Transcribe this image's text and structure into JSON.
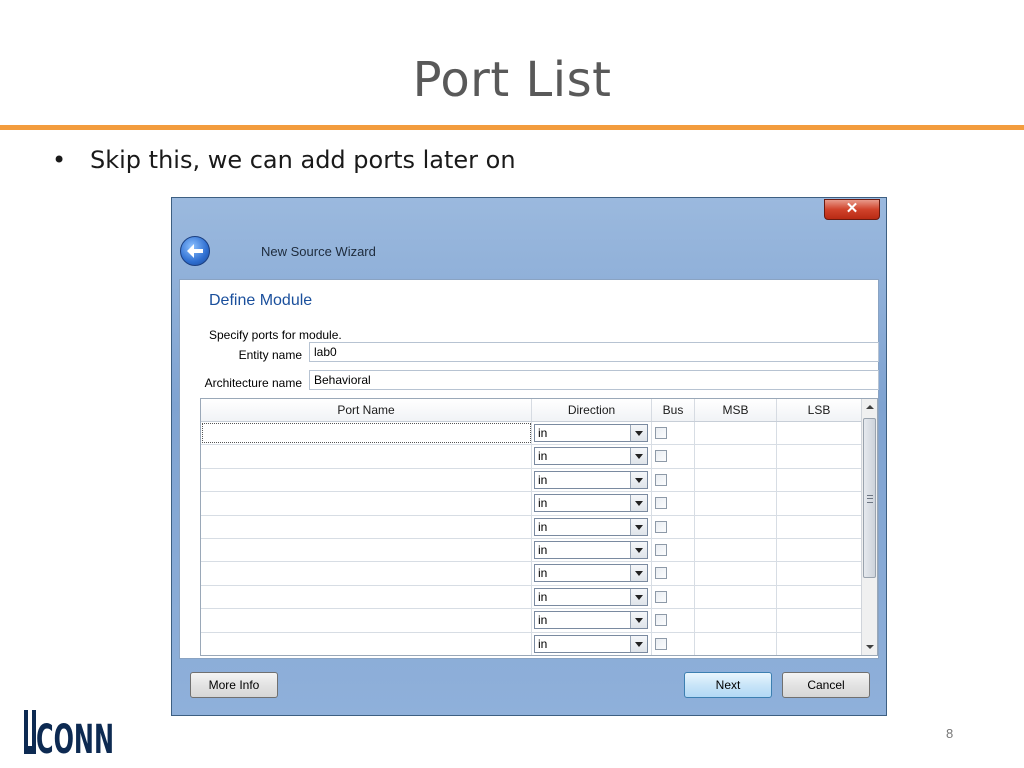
{
  "slide": {
    "title": "Port List",
    "bullets": [
      "Skip this, we can add ports later on"
    ],
    "page_number": "8",
    "logo_text": "UCONN",
    "accent_color": "#f39c3d"
  },
  "window": {
    "title": "New Source Wizard",
    "close_label": "✕",
    "heading": "Define Module",
    "instruction": "Specify ports for module.",
    "entity_name_label": "Entity name",
    "entity_name_value": "lab0",
    "architecture_name_label": "Architecture name",
    "architecture_name_value": "Behavioral",
    "table": {
      "columns": [
        "Port Name",
        "Direction",
        "Bus",
        "MSB",
        "LSB"
      ],
      "rows": [
        {
          "port_name": "",
          "direction": "in",
          "bus": false,
          "msb": "",
          "lsb": ""
        },
        {
          "port_name": "",
          "direction": "in",
          "bus": false,
          "msb": "",
          "lsb": ""
        },
        {
          "port_name": "",
          "direction": "in",
          "bus": false,
          "msb": "",
          "lsb": ""
        },
        {
          "port_name": "",
          "direction": "in",
          "bus": false,
          "msb": "",
          "lsb": ""
        },
        {
          "port_name": "",
          "direction": "in",
          "bus": false,
          "msb": "",
          "lsb": ""
        },
        {
          "port_name": "",
          "direction": "in",
          "bus": false,
          "msb": "",
          "lsb": ""
        },
        {
          "port_name": "",
          "direction": "in",
          "bus": false,
          "msb": "",
          "lsb": ""
        },
        {
          "port_name": "",
          "direction": "in",
          "bus": false,
          "msb": "",
          "lsb": ""
        },
        {
          "port_name": "",
          "direction": "in",
          "bus": false,
          "msb": "",
          "lsb": ""
        },
        {
          "port_name": "",
          "direction": "in",
          "bus": false,
          "msb": "",
          "lsb": ""
        }
      ]
    },
    "buttons": {
      "more_info": "More Info",
      "next": "Next",
      "cancel": "Cancel"
    }
  }
}
